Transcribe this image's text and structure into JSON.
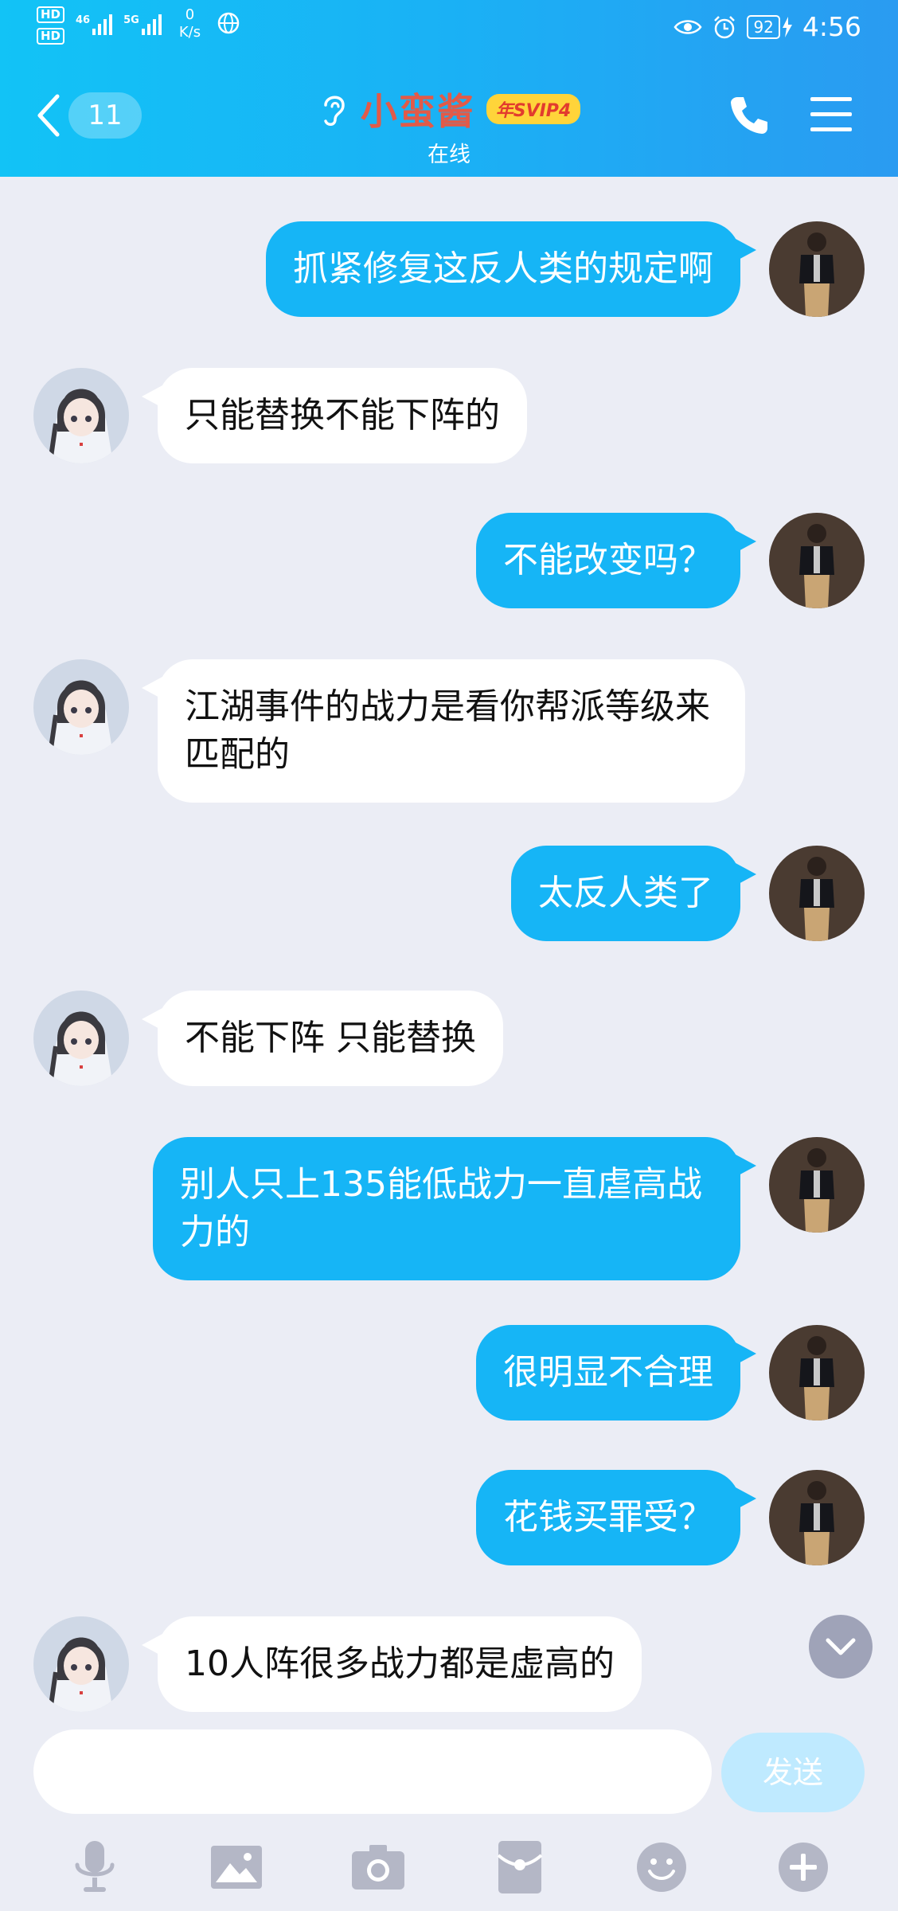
{
  "status_bar": {
    "hd1": "HD",
    "hd2": "HD",
    "sig1_label": "46",
    "sig2_label": "5G",
    "net_speed_value": "0",
    "net_speed_unit": "K/s",
    "battery": "92",
    "time": "4:56"
  },
  "header": {
    "unread_count": "11",
    "contact_name": "小蛮酱",
    "vip_badge": "年SVIP4",
    "contact_status": "在线"
  },
  "messages": [
    {
      "side": "out",
      "text": "抓紧修复这反人类的规定啊"
    },
    {
      "side": "in",
      "text": "只能替换不能下阵的"
    },
    {
      "side": "out",
      "text": "不能改变吗？"
    },
    {
      "side": "in",
      "text": "江湖事件的战力是看你帮派等级来匹配的"
    },
    {
      "side": "out",
      "text": "太反人类了"
    },
    {
      "side": "in",
      "text": "不能下阵 只能替换"
    },
    {
      "side": "out",
      "text": "别人只上135能低战力一直虐高战力的"
    },
    {
      "side": "out",
      "text": "很明显不合理"
    },
    {
      "side": "out",
      "text": "花钱买罪受？"
    },
    {
      "side": "in",
      "text": "10人阵很多战力都是虚高的"
    }
  ],
  "input": {
    "value": "",
    "send_label": "发送"
  },
  "toolbar": {
    "icons": [
      "microphone-icon",
      "image-icon",
      "camera-icon",
      "red-packet-icon",
      "emoji-icon",
      "plus-icon"
    ]
  },
  "colors": {
    "header_start": "#12c3f6",
    "header_end": "#2a9bf1",
    "outgoing_bubble": "#16b5f6",
    "incoming_bubble": "#ffffff",
    "chat_bg": "#ebedf5",
    "contact_name": "#e25a48",
    "send_disabled": "#bfeaff"
  }
}
